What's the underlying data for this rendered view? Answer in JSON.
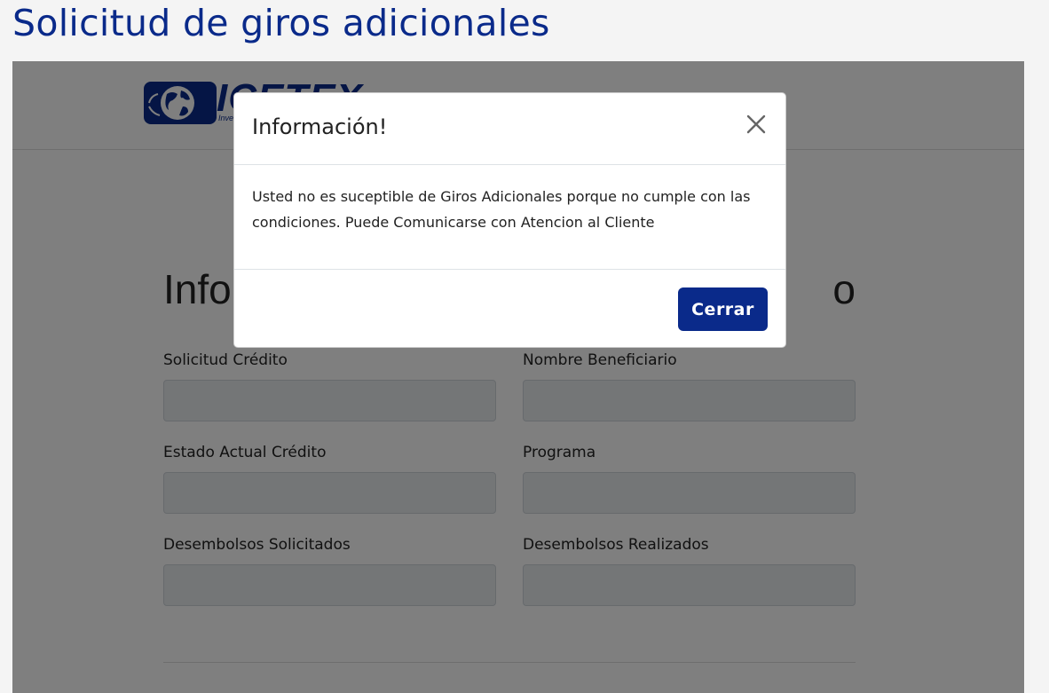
{
  "page": {
    "title": "Solicitud de giros adicionales"
  },
  "logo": {
    "text": "ICETEX",
    "subtitle": "Inve"
  },
  "form": {
    "section_title_start": "Info",
    "section_title_end": "o",
    "fields": [
      {
        "label": "Solicitud Crédito",
        "value": ""
      },
      {
        "label": "Nombre Beneficiario",
        "value": ""
      },
      {
        "label": "Estado Actual Crédito",
        "value": ""
      },
      {
        "label": "Programa",
        "value": ""
      },
      {
        "label": "Desembolsos Solicitados",
        "value": ""
      },
      {
        "label": "Desembolsos Realizados",
        "value": ""
      }
    ]
  },
  "modal": {
    "title": "Información!",
    "message": "Usted no es suceptible de Giros Adicionales porque no cumple con las condiciones. Puede Comunicarse con Atencion al Cliente",
    "close_icon": "close-icon",
    "close_button_label": "Cerrar"
  },
  "colors": {
    "brand_blue": "#0a2a8a",
    "backdrop": "rgba(0,0,0,0.5)"
  }
}
